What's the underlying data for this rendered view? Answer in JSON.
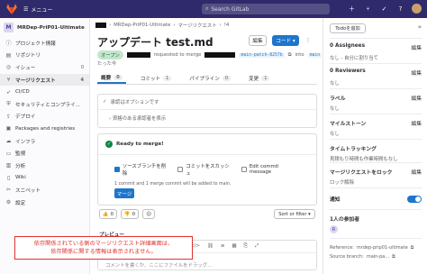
{
  "topbar": {
    "menu_label": "メニュー",
    "search_placeholder": "Search GitLab"
  },
  "sidebar": {
    "project_initial": "M",
    "project_name": "MRDep-PriP01-Ultimate",
    "items": [
      {
        "label": "プロジェクト情報",
        "icon": "info-icon"
      },
      {
        "label": "リポジトリ",
        "icon": "repository-icon"
      },
      {
        "label": "イシュー",
        "icon": "issues-icon",
        "badge": "0"
      },
      {
        "label": "マージリクエスト",
        "icon": "merge-request-icon",
        "badge": "4"
      },
      {
        "label": "CI/CD",
        "icon": "rocket-icon"
      },
      {
        "label": "セキュリティとコンプライ...",
        "icon": "shield-icon"
      },
      {
        "label": "デプロイ",
        "icon": "deploy-icon"
      },
      {
        "label": "Packages and registries",
        "icon": "package-icon"
      },
      {
        "label": "インフラ",
        "icon": "cloud-icon"
      },
      {
        "label": "監視",
        "icon": "monitor-icon"
      },
      {
        "label": "分析",
        "icon": "chart-icon"
      },
      {
        "label": "Wiki",
        "icon": "book-icon"
      },
      {
        "label": "スニペット",
        "icon": "snippet-icon"
      },
      {
        "label": "設定",
        "icon": "settings-icon"
      }
    ]
  },
  "breadcrumb": {
    "project": "MRDep-PriP01-Ultimate",
    "section": "マージリクエスト",
    "id": "!4"
  },
  "mr": {
    "title": "アップデート test.md",
    "edit_label": "編集",
    "code_label": "コード ▾",
    "status": "オープン",
    "requested_text": "requested to merge",
    "source_branch": "main-patch-8257b",
    "into_text": "into",
    "target_branch": "main",
    "time_ago": "たった今"
  },
  "tabs": [
    {
      "label": "概要",
      "count": "0"
    },
    {
      "label": "コミット",
      "count": "1"
    },
    {
      "label": "パイプライン",
      "count": "0"
    },
    {
      "label": "変更",
      "count": "1"
    }
  ],
  "approval": {
    "optional_text": "承認はオプションです",
    "rules_text": "資格のある承認者を表示"
  },
  "merge_widget": {
    "ready_text": "Ready to merge!",
    "delete_branch": "ソースブランチを削除",
    "squash": "コミットをスカッシュ",
    "edit_commit": "Edit commit message",
    "info_text": "1 commit and 1 merge commit will be added to main.",
    "merge_button": "マージ"
  },
  "reactions": {
    "thumbs_up": "0",
    "thumbs_down": "0",
    "sort_label": "Sort or filter"
  },
  "comment": {
    "preview_label": "プレビュー",
    "placeholder": "コメントを書くか、ここにファイルをドラッグ..."
  },
  "annotation": {
    "line1": "依存関係されている側のマージリクエスト詳細画面は、",
    "line2": "依存関係に関する情報は表示されません。"
  },
  "right_sidebar": {
    "todo_label": "Todoを追加",
    "assignees_title": "0 Assignees",
    "assignees_value": "なし - 自分に割り当て",
    "reviewers_title": "0 Reviewers",
    "reviewers_value": "なし",
    "labels_title": "ラベル",
    "labels_value": "なし",
    "milestone_title": "マイルストーン",
    "milestone_value": "なし",
    "time_title": "タイムトラッキング",
    "time_value": "見積もり時間も作業時間もなし",
    "lock_title": "マージリクエストをロック",
    "lock_value": "ロック解除",
    "notify_title": "通知",
    "participants_title": "1人の参加者",
    "participant_initial": "R",
    "reference_label": "Reference:",
    "reference_value": "mrdep-prip01-ultimate",
    "source_label": "Source branch:",
    "source_value": "main-pa..."
  },
  "edit_label": "編集",
  "colors": {
    "navbar": "#2f2a6b",
    "primary": "#1f75cb",
    "success": "#108548",
    "annotation": "#e0332d"
  }
}
